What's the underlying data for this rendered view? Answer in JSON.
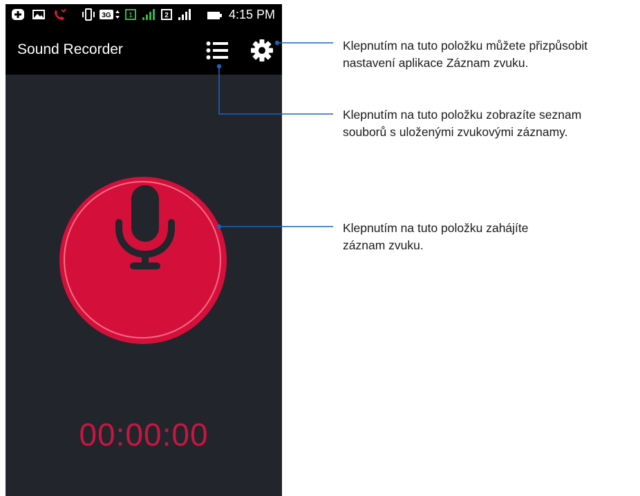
{
  "status_bar": {
    "time": "4:15 PM",
    "icons": [
      "plus-notification-icon",
      "image-icon",
      "missed-call-icon",
      "vibrate-icon",
      "3g-data-icon",
      "sim1-icon",
      "signal-icon",
      "sim2-icon",
      "signal-icon",
      "battery-icon"
    ],
    "accent_colors": {
      "missed_call": "#d81b3b",
      "sim1": "#39b54a",
      "signal_active": "#39b54a"
    },
    "sim_labels": [
      "1",
      "2"
    ],
    "data_label": "3G"
  },
  "app_bar": {
    "title": "Sound Recorder",
    "actions": [
      "list-icon",
      "settings-gear-icon"
    ]
  },
  "recorder": {
    "button_color": "#d4103a",
    "icon": "microphone-icon",
    "timer": "00:00:00",
    "timer_color": "#c8163f"
  },
  "annotations": [
    {
      "id": "settings",
      "text_line1": "Klepnutím na tuto položku můžete přizpůsobit",
      "text_line2": "nastavení aplikace Záznam zvuku."
    },
    {
      "id": "list",
      "text_line1": "Klepnutím na tuto položku zobrazíte seznam",
      "text_line2": "souborů s uloženými zvukovými záznamy."
    },
    {
      "id": "record",
      "text_line1": "Klepnutím na tuto položku zahájíte",
      "text_line2": "záznam zvuku."
    }
  ],
  "leader_color": "#1565c0"
}
